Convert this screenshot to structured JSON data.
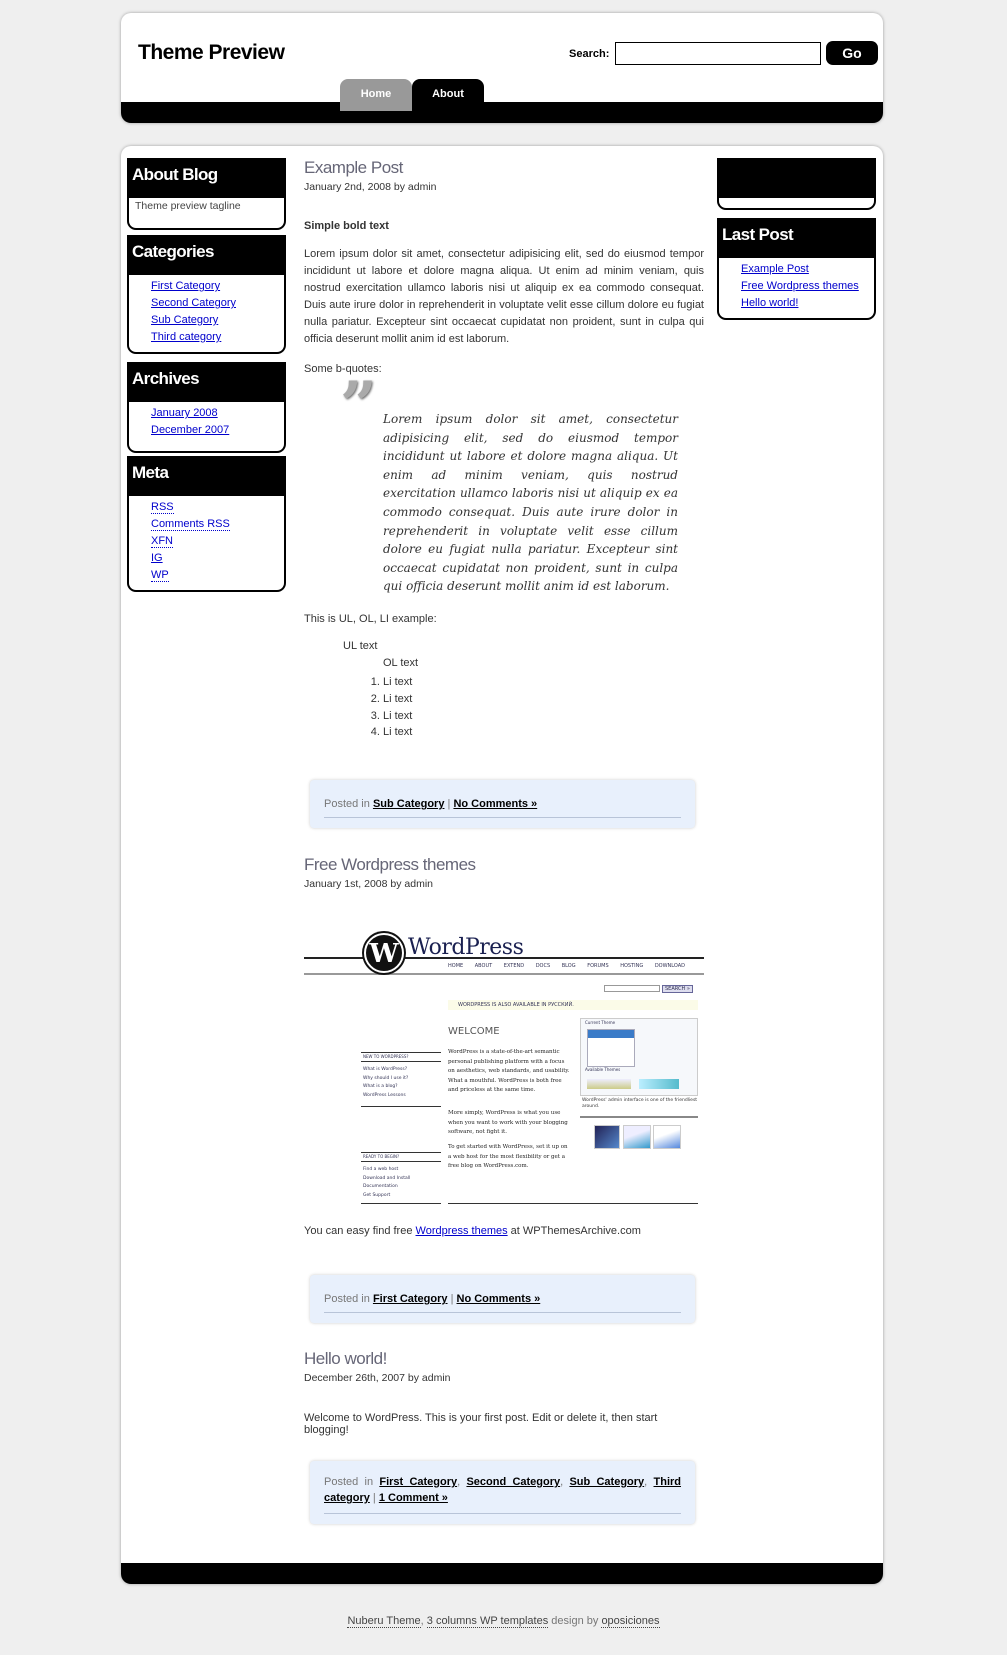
{
  "header": {
    "title": "Theme Preview",
    "search_label": "Search:",
    "search_value": "",
    "go_label": "Go",
    "tabs": [
      {
        "label": "Home",
        "active": false
      },
      {
        "label": "About",
        "active": true
      }
    ]
  },
  "left_sidebar": {
    "about": {
      "title": "About Blog",
      "tagline": "Theme preview tagline"
    },
    "categories": {
      "title": "Categories",
      "items": [
        "First Category",
        "Second Category",
        "Sub Category",
        "Third category"
      ]
    },
    "archives": {
      "title": "Archives",
      "items": [
        "January 2008",
        "December 2007"
      ]
    },
    "meta": {
      "title": "Meta",
      "items": [
        "RSS",
        "Comments RSS",
        "XFN",
        "IG",
        "WP"
      ]
    }
  },
  "right_sidebar": {
    "last_post": {
      "title": "Last Post",
      "items": [
        "Example Post",
        "Free Wordpress themes",
        "Hello world!"
      ]
    }
  },
  "posts": [
    {
      "title": "Example Post",
      "date": "January 2nd, 2008 by admin",
      "bold": "Simple bold text",
      "paragraph": "Lorem ipsum dolor sit amet, consectetur adipisicing elit, sed do eiusmod tempor incididunt ut labore et dolore magna aliqua. Ut enim ad minim veniam, quis nostrud exercitation ullamco laboris nisi ut aliquip ex ea commodo consequat. Duis aute irure dolor in reprehenderit in voluptate velit esse cillum dolore eu fugiat nulla pariatur. Excepteur sint occaecat cupidatat non proident, sunt in culpa qui officia deserunt mollit anim id est laborum.",
      "bquote_intro": "Some b-quotes:",
      "bquote": "Lorem ipsum dolor sit amet, consectetur adipisicing elit, sed do eiusmod tempor incididunt ut labore et dolore magna aliqua. Ut enim ad minim veniam, quis nostrud exercitation ullamco laboris nisi ut aliquip ex ea commodo consequat. Duis aute irure dolor in reprehenderit in voluptate velit esse cillum dolore eu fugiat nulla pariatur. Excepteur sint occaecat cupidatat non proident, sunt in culpa qui officia deserunt mollit anim id est laborum.",
      "list_intro": "This is UL, OL, LI example:",
      "ul_text": "UL text",
      "ol_text": "OL text",
      "li": [
        "Li text",
        "Li text",
        "Li text",
        "Li text"
      ],
      "meta": {
        "posted_in": "Posted in",
        "cats": [
          "Sub Category"
        ],
        "sep": "|",
        "comments": "No Comments »"
      }
    },
    {
      "title": "Free Wordpress themes",
      "date": "January 1st, 2008 by admin",
      "text_before": "You can easy find free ",
      "link": "Wordpress themes",
      "text_after": " at WPThemesArchive.com",
      "meta": {
        "posted_in": "Posted in",
        "cats": [
          "First Category"
        ],
        "sep": "|",
        "comments": "No Comments »"
      }
    },
    {
      "title": "Hello world!",
      "date": "December 26th, 2007 by admin",
      "text": "Welcome to WordPress. This is your first post. Edit or delete it, then start blogging!",
      "meta": {
        "posted_in": "Posted in",
        "cats": [
          "First Category",
          "Second Category",
          "Sub Category",
          "Third category"
        ],
        "sep": "|",
        "comments": "1 Comment »"
      }
    }
  ],
  "wp_image": {
    "logo": "WordPress",
    "nav": [
      "HOME",
      "ABOUT",
      "EXTEND",
      "DOCS",
      "BLOG",
      "FORUMS",
      "HOSTING",
      "DOWNLOAD"
    ],
    "search": "SEARCH »",
    "notice": "WORDPRESS IS ALSO AVAILABLE IN РУССКИЙ.",
    "welcome": "WELCOME",
    "new_heading": "NEW TO WORDPRESS?",
    "new_items": [
      "What is WordPress?",
      "Why should I use it?",
      "What is a blog?",
      "WordPress Lessons"
    ],
    "ready_heading": "READY TO BEGIN?",
    "ready_items": [
      "Find a web host",
      "Download and Install",
      "Documentation",
      "Get Support"
    ],
    "intro": "WordPress is a state-of-the-art semantic personal publishing platform with a focus on aesthetics, web standards, and usability. What a mouthful. WordPress is both free and priceless at the same time.",
    "more": "More simply, WordPress is what you use when you want to work with your blogging software, not fight it.",
    "start": "To get started with WordPress, set it up on a web host for the most flexibility or get a free blog on WordPress.com.",
    "current_theme": "Current Theme",
    "available": "Available Themes",
    "caption": "WordPress' admin interface is one of the friendliest around."
  },
  "footer": {
    "theme": "Nuberu Theme",
    "sep": ", ",
    "templates": "3 columns WP templates",
    "design_by": " design by ",
    "author": "oposiciones"
  },
  "colors": {
    "accent": "#000000",
    "tab_inactive": "#999999",
    "post_title": "#666677",
    "meta_bg": "#e8f0fc",
    "link": "#0000cc",
    "page_bg": "#efefef"
  }
}
